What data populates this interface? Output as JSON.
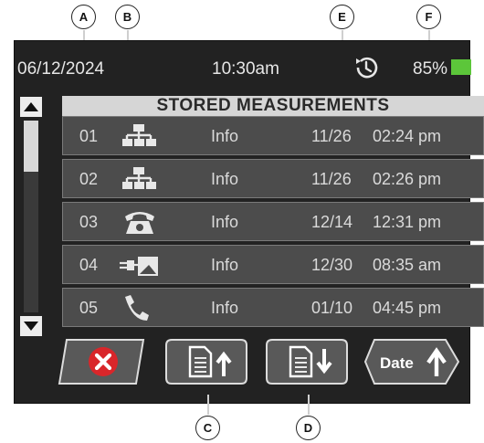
{
  "callouts": {
    "a": "A",
    "b": "B",
    "c": "C",
    "d": "D",
    "e": "E",
    "f": "F"
  },
  "status": {
    "date": "06/12/2024",
    "time": "10:30am",
    "battery_pct": "85%",
    "history_icon": "history-icon",
    "battery_color": "#5cc63a"
  },
  "list": {
    "title": "STORED MEASUREMENTS",
    "rows": [
      {
        "num": "01",
        "icon": "network-icon",
        "info": "Info",
        "date": "11/26",
        "time": "02:24 pm"
      },
      {
        "num": "02",
        "icon": "network-icon",
        "info": "Info",
        "date": "11/26",
        "time": "02:26 pm"
      },
      {
        "num": "03",
        "icon": "telephone-icon",
        "info": "Info",
        "date": "12/14",
        "time": "12:31 pm"
      },
      {
        "num": "04",
        "icon": "cable-device-icon",
        "info": "Info",
        "date": "12/30",
        "time": "08:35 am"
      },
      {
        "num": "05",
        "icon": "phone-handset-icon",
        "info": "Info",
        "date": "01/10",
        "time": "04:45 pm"
      }
    ]
  },
  "scrollbar": {
    "up_icon": "scroll-up-icon",
    "down_icon": "scroll-down-icon"
  },
  "toolbar": {
    "delete_icon": "close-icon",
    "export_icon": "document-upload-icon",
    "import_icon": "document-download-icon",
    "sort_label": "Date",
    "sort_icon": "arrow-up-icon",
    "delete_color": "#d9262a"
  }
}
